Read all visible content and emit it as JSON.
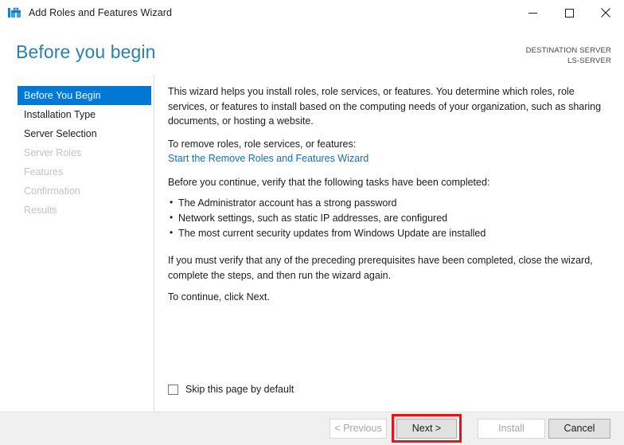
{
  "window": {
    "title": "Add Roles and Features Wizard",
    "icon": "wizard-toolbox-icon",
    "controls": {
      "minimize": "minimize-icon",
      "maximize": "maximize-icon",
      "close": "close-icon"
    }
  },
  "header": {
    "page_title": "Before you begin",
    "destination_label": "DESTINATION SERVER",
    "destination_server": "LS-SERVER",
    "title_color": "#2c7fa9"
  },
  "sidebar": {
    "items": [
      {
        "label": "Before You Begin",
        "state": "selected"
      },
      {
        "label": "Installation Type",
        "state": "enabled"
      },
      {
        "label": "Server Selection",
        "state": "enabled"
      },
      {
        "label": "Server Roles",
        "state": "disabled"
      },
      {
        "label": "Features",
        "state": "disabled"
      },
      {
        "label": "Confirmation",
        "state": "disabled"
      },
      {
        "label": "Results",
        "state": "disabled"
      }
    ],
    "selected_color": "#0078d4"
  },
  "content": {
    "intro": "This wizard helps you install roles, role services, or features. You determine which roles, role services, or features to install based on the computing needs of your organization, such as sharing documents, or hosting a website.",
    "remove_prompt": "To remove roles, role services, or features:",
    "remove_link": "Start the Remove Roles and Features Wizard",
    "link_color": "#1a6ea8",
    "verify_prompt": "Before you continue, verify that the following tasks have been completed:",
    "tasks": [
      "The Administrator account has a strong password",
      "Network settings, such as static IP addresses, are configured",
      "The most current security updates from Windows Update are installed"
    ],
    "verify_note": "If you must verify that any of the preceding prerequisites have been completed, close the wizard, complete the steps, and then run the wizard again.",
    "continue_note": "To continue, click Next."
  },
  "options": {
    "skip_label": "Skip this page by default",
    "skip_checked": false
  },
  "footer": {
    "buttons": [
      {
        "label": "< Previous",
        "state": "disabled"
      },
      {
        "label": "Next >",
        "state": "enabled"
      },
      {
        "label": "Install",
        "state": "disabled"
      },
      {
        "label": "Cancel",
        "state": "enabled"
      }
    ]
  },
  "annotation": {
    "highlight_target": "Next >",
    "highlight_color": "#e8121a"
  }
}
